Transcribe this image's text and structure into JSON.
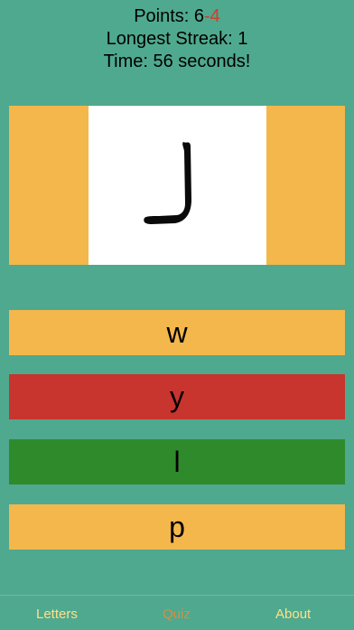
{
  "stats": {
    "points_label": "Points: 6",
    "points_penalty": "-4",
    "streak_text": "Longest Streak: 1",
    "time_text": "Time: 56 seconds!"
  },
  "card": {
    "letter": "ل"
  },
  "answers": [
    {
      "label": "w",
      "state": "default"
    },
    {
      "label": "y",
      "state": "incorrect"
    },
    {
      "label": "l",
      "state": "correct"
    },
    {
      "label": "p",
      "state": "default"
    }
  ],
  "tabs": [
    {
      "label": "Letters",
      "active": false
    },
    {
      "label": "Quiz",
      "active": true
    },
    {
      "label": "About",
      "active": false
    }
  ],
  "colors": {
    "background": "#4fa98e",
    "accent": "#f4b74c",
    "incorrect": "#c7352e",
    "correct": "#2f8a2c",
    "penalty_text": "#d63a2a"
  }
}
